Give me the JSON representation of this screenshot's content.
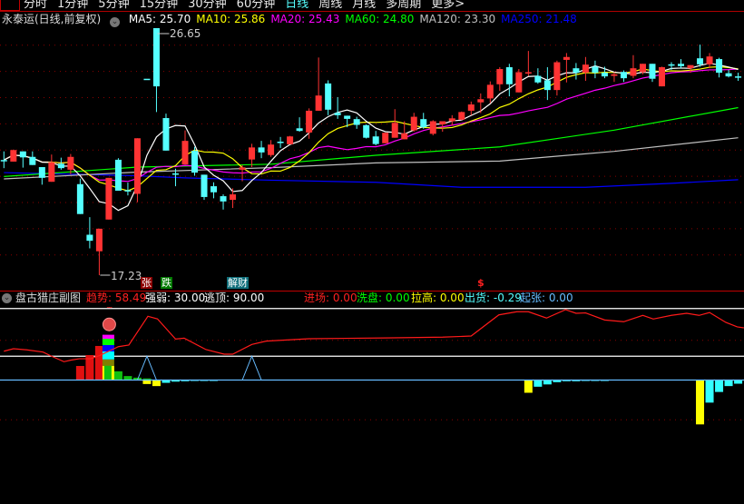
{
  "period_tabs": [
    "分时",
    "1分钟",
    "5分钟",
    "15分钟",
    "30分钟",
    "60分钟",
    "日线",
    "周线",
    "月线",
    "多周期",
    "更多>"
  ],
  "active_tab": "日线",
  "header": {
    "title": "永泰运(日线,前复权)",
    "ma": [
      {
        "label": "MA5: 25.70",
        "color": "#ffffff"
      },
      {
        "label": "MA10: 25.86",
        "color": "#ffff00"
      },
      {
        "label": "MA20: 25.43",
        "color": "#ff00ff"
      },
      {
        "label": "MA60: 24.80",
        "color": "#00ff00"
      },
      {
        "label": "MA120: 23.30",
        "color": "#c0c0c0"
      },
      {
        "label": "MA250: 21.48",
        "color": "#0000ff"
      }
    ]
  },
  "price_labels": {
    "high": "26.65",
    "low": "17.23"
  },
  "signal_tags": [
    {
      "text": "张",
      "bg": "#8b0000"
    },
    {
      "text": "跌",
      "bg": "#007a00"
    },
    {
      "text": "解财",
      "bg": "#0e6e7a"
    },
    {
      "text": "$",
      "bg": "transparent"
    }
  ],
  "sub_header": {
    "title": "盘古猎庄副图",
    "items": [
      {
        "label": "趋势: 58.49",
        "color": "#ff2020"
      },
      {
        "label": "强弱: 30.00",
        "color": "#ffffff"
      },
      {
        "label": "逃顶: 90.00",
        "color": "#ffffff"
      },
      {
        "label": "进场: 0.00",
        "color": "#ff2020"
      },
      {
        "label": "洗盘: 0.00",
        "color": "#00ff00"
      },
      {
        "label": "拉高: 0.00",
        "color": "#ffff00"
      },
      {
        "label": "出货: -0.29",
        "color": "#55ffff"
      },
      {
        "label": "起张: 0.00",
        "color": "#66bbff"
      }
    ]
  },
  "colors": {
    "up": "#ff3333",
    "down": "#55ffff",
    "grid": "#8b0000"
  },
  "chart_data": {
    "type": "candlestick",
    "ohlc": [
      [
        21.62,
        21.95,
        21.31,
        21.62
      ],
      [
        21.56,
        22.02,
        21.56,
        22.0
      ],
      [
        21.95,
        21.95,
        21.33,
        21.72
      ],
      [
        21.74,
        21.95,
        21.43,
        21.43
      ],
      [
        21.35,
        21.35,
        20.68,
        20.94
      ],
      [
        20.79,
        21.83,
        20.79,
        21.54
      ],
      [
        21.48,
        21.71,
        21.25,
        21.31
      ],
      [
        21.25,
        21.85,
        21.08,
        21.74
      ],
      [
        20.7,
        20.91,
        19.56,
        19.56
      ],
      [
        18.77,
        19.44,
        18.25,
        18.54
      ],
      [
        18.14,
        19.0,
        17.23,
        19.0
      ],
      [
        19.35,
        20.94,
        19.35,
        20.94
      ],
      [
        21.63,
        21.69,
        20.45,
        20.45
      ],
      [
        20.47,
        20.76,
        20.27,
        20.45
      ],
      [
        20.33,
        22.45,
        20.01,
        22.45
      ],
      [
        24.72,
        24.72,
        24.72,
        24.72
      ],
      [
        26.65,
        26.65,
        23.45,
        24.43
      ],
      [
        23.22,
        23.39,
        21.98,
        21.98
      ],
      [
        21.11,
        21.29,
        20.62,
        21.11
      ],
      [
        21.45,
        22.75,
        21.45,
        22.35
      ],
      [
        21.97,
        22.12,
        21.02,
        21.14
      ],
      [
        21.06,
        21.06,
        20.1,
        20.21
      ],
      [
        20.62,
        20.77,
        20.16,
        20.39
      ],
      [
        20.24,
        20.31,
        19.73,
        20.04
      ],
      [
        20.1,
        20.54,
        19.79,
        20.31
      ],
      [
        21.25,
        21.43,
        20.81,
        21.34
      ],
      [
        21.64,
        22.24,
        21.35,
        22.1
      ],
      [
        22.1,
        22.35,
        21.69,
        21.91
      ],
      [
        21.81,
        22.38,
        21.74,
        22.21
      ],
      [
        22.32,
        22.5,
        22.08,
        22.32
      ],
      [
        22.22,
        22.54,
        22.22,
        22.52
      ],
      [
        22.83,
        23.25,
        22.7,
        22.73
      ],
      [
        22.67,
        23.59,
        22.43,
        23.5
      ],
      [
        23.5,
        25.53,
        23.5,
        24.08
      ],
      [
        24.54,
        24.66,
        23.33,
        23.54
      ],
      [
        23.42,
        24.02,
        23.19,
        23.33
      ],
      [
        23.31,
        23.31,
        22.87,
        23.19
      ],
      [
        23.18,
        23.27,
        22.81,
        22.96
      ],
      [
        22.95,
        22.98,
        22.44,
        22.47
      ],
      [
        22.52,
        22.73,
        22.18,
        22.23
      ],
      [
        22.26,
        22.66,
        22.26,
        22.66
      ],
      [
        22.47,
        23.56,
        22.47,
        23.04
      ],
      [
        22.41,
        23.1,
        22.41,
        22.64
      ],
      [
        22.75,
        23.42,
        22.7,
        23.27
      ],
      [
        23.18,
        23.42,
        22.81,
        22.87
      ],
      [
        22.62,
        23.14,
        22.56,
        23.1
      ],
      [
        22.98,
        23.1,
        22.7,
        23.1
      ],
      [
        23.1,
        23.33,
        22.93,
        23.21
      ],
      [
        23.16,
        23.47,
        23.14,
        23.45
      ],
      [
        23.5,
        23.85,
        23.33,
        23.74
      ],
      [
        23.82,
        24.16,
        23.41,
        23.94
      ],
      [
        23.97,
        24.62,
        23.79,
        24.49
      ],
      [
        24.51,
        25.16,
        24.26,
        25.09
      ],
      [
        25.16,
        25.29,
        24.05,
        24.51
      ],
      [
        24.2,
        25.09,
        24.2,
        24.97
      ],
      [
        24.93,
        25.78,
        24.83,
        24.97
      ],
      [
        24.83,
        25.12,
        24.53,
        24.58
      ],
      [
        24.66,
        25.16,
        23.91,
        24.29
      ],
      [
        24.29,
        25.41,
        24.08,
        25.35
      ],
      [
        25.44,
        25.7,
        24.58,
        25.55
      ],
      [
        25.12,
        25.32,
        24.69,
        24.95
      ],
      [
        24.95,
        25.55,
        24.64,
        25.26
      ],
      [
        25.18,
        25.41,
        24.74,
        24.95
      ],
      [
        24.95,
        25.18,
        24.74,
        24.81
      ],
      [
        24.83,
        24.97,
        24.6,
        24.89
      ],
      [
        24.98,
        25.04,
        24.6,
        24.74
      ],
      [
        24.83,
        25.62,
        24.74,
        25.12
      ],
      [
        24.97,
        25.29,
        24.89,
        25.29
      ],
      [
        25.29,
        25.29,
        24.6,
        24.72
      ],
      [
        24.43,
        25.18,
        24.43,
        25.16
      ],
      [
        25.27,
        25.35,
        25.06,
        25.27
      ],
      [
        25.29,
        25.47,
        25.12,
        25.2
      ],
      [
        25.12,
        25.24,
        24.95,
        25.24
      ],
      [
        25.5,
        26.02,
        25.18,
        25.27
      ],
      [
        25.27,
        25.7,
        25.12,
        25.57
      ],
      [
        25.47,
        25.52,
        24.77,
        24.95
      ],
      [
        24.93,
        25.06,
        24.77,
        24.81
      ],
      [
        24.81,
        24.95,
        24.64,
        24.77
      ]
    ],
    "ma_long": {
      "MA60": [
        [
          0,
          20.99
        ],
        [
          14,
          21.35
        ],
        [
          28,
          21.46
        ],
        [
          39,
          21.8
        ],
        [
          52,
          22.12
        ],
        [
          64,
          22.76
        ],
        [
          77,
          23.62
        ]
      ],
      "MA120": [
        [
          0,
          20.9
        ],
        [
          14,
          21.16
        ],
        [
          28,
          21.33
        ],
        [
          39,
          21.51
        ],
        [
          52,
          21.58
        ],
        [
          64,
          21.95
        ],
        [
          77,
          22.47
        ]
      ],
      "MA250": [
        [
          0,
          21.14
        ],
        [
          14,
          21.02
        ],
        [
          19,
          20.94
        ],
        [
          28,
          20.85
        ],
        [
          39,
          20.77
        ],
        [
          48,
          20.58
        ],
        [
          61,
          20.58
        ],
        [
          70,
          20.73
        ],
        [
          77,
          20.87
        ]
      ]
    },
    "y_range": [
      17.23,
      26.65
    ],
    "sub": {
      "levels": [
        90,
        30,
        0
      ],
      "trend": [
        [
          0,
          36.3
        ],
        [
          1,
          39.4
        ],
        [
          2.4,
          38
        ],
        [
          4.1,
          35.2
        ],
        [
          5,
          30
        ],
        [
          6.3,
          23.1
        ],
        [
          7,
          25
        ],
        [
          7.9,
          26.8
        ],
        [
          9.1,
          26.8
        ],
        [
          10,
          30.7
        ],
        [
          12,
          42
        ],
        [
          13.1,
          44
        ],
        [
          15.1,
          80.2
        ],
        [
          16.1,
          77
        ],
        [
          18,
          51.6
        ],
        [
          18.9,
          52.7
        ],
        [
          21.2,
          38.3
        ],
        [
          23.1,
          32.6
        ],
        [
          24,
          32.6
        ],
        [
          26,
          44.8
        ],
        [
          27.5,
          49
        ],
        [
          32,
          52
        ],
        [
          40,
          53
        ],
        [
          46,
          54
        ],
        [
          49,
          55.4
        ],
        [
          51.9,
          82
        ],
        [
          53.8,
          86
        ],
        [
          55,
          86
        ],
        [
          56.9,
          78
        ],
        [
          58.9,
          88.6
        ],
        [
          60,
          84
        ],
        [
          61,
          84.5
        ],
        [
          63,
          75.6
        ],
        [
          65,
          73.4
        ],
        [
          67,
          81.4
        ],
        [
          68.1,
          76.8
        ],
        [
          70,
          81.4
        ],
        [
          71.6,
          84
        ],
        [
          72.9,
          81.4
        ],
        [
          74,
          85
        ],
        [
          75.7,
          72.6
        ],
        [
          76.9,
          66.9
        ],
        [
          77.6,
          65.7
        ]
      ],
      "red_bars": [
        [
          8,
          17.7
        ],
        [
          9,
          31.4
        ],
        [
          10,
          42.9
        ]
      ],
      "green_bars": [
        [
          12,
          11
        ],
        [
          13,
          5
        ],
        [
          14,
          3
        ],
        [
          15,
          2
        ]
      ],
      "yellow_bars": [
        [
          15,
          -5
        ],
        [
          16,
          -7.6
        ],
        [
          55,
          -16
        ],
        [
          73,
          -55.8
        ]
      ],
      "cyan_bars": [
        [
          17,
          -3.5
        ],
        [
          18,
          -2
        ],
        [
          19,
          -1.5
        ],
        [
          20,
          -1
        ],
        [
          21,
          -1
        ],
        [
          22,
          -1
        ],
        [
          56,
          -8.4
        ],
        [
          57,
          -5.5
        ],
        [
          58,
          -2.7
        ],
        [
          59,
          -1.5
        ],
        [
          60,
          -1.5
        ],
        [
          61,
          -1
        ],
        [
          62,
          -1
        ],
        [
          63,
          -1
        ],
        [
          74,
          -28.4
        ],
        [
          75,
          -15
        ],
        [
          76,
          -7.6
        ],
        [
          77,
          -4.6
        ]
      ],
      "triangles": [
        [
          15,
          30
        ],
        [
          26,
          30
        ]
      ],
      "stack_index": 11
    }
  }
}
